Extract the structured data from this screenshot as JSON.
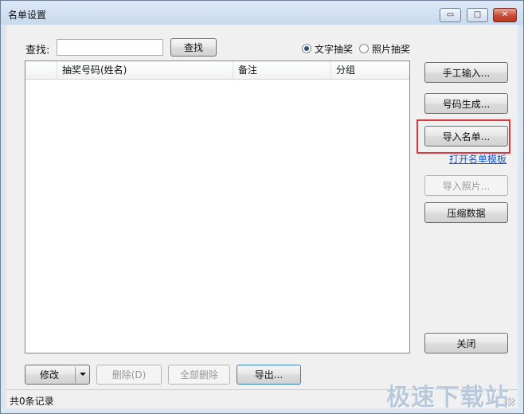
{
  "window": {
    "title": "名单设置"
  },
  "caption_buttons": {
    "minimize": "▭",
    "maximize": "□",
    "close": "✕"
  },
  "search": {
    "label": "查找:",
    "value": "",
    "button": "查找"
  },
  "mode": {
    "options": [
      {
        "label": "文字抽奖",
        "selected": true
      },
      {
        "label": "照片抽奖",
        "selected": false
      }
    ]
  },
  "list": {
    "columns": [
      "抽奖号码(姓名)",
      "备注",
      "分组"
    ],
    "rows": []
  },
  "right_buttons": {
    "manual_input": "手工输入...",
    "generate_numbers": "号码生成...",
    "import_list": "导入名单...",
    "open_template_link": "打开名单模板",
    "import_photos": "导入照片...",
    "compress_data": "压缩数据",
    "close": "关闭"
  },
  "bottom_buttons": {
    "modify": "修改",
    "delete": "删除(D)",
    "delete_all": "全部删除",
    "export": "导出..."
  },
  "status": {
    "text": "共0条记录"
  },
  "watermark": {
    "text": "极速下载站"
  }
}
